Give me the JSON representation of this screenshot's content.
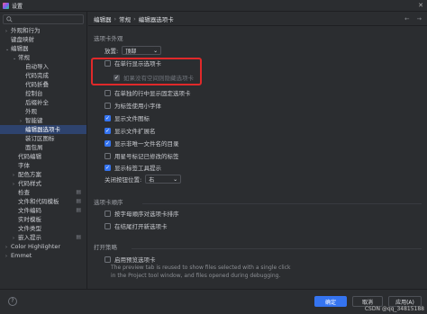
{
  "window": {
    "title": "设置"
  },
  "search": {
    "placeholder": ""
  },
  "sidebar": {
    "items": [
      {
        "label": "外观和行为",
        "indent": 0,
        "arrow": "›"
      },
      {
        "label": "键盘映射",
        "indent": 0,
        "arrow": ""
      },
      {
        "label": "编辑器",
        "indent": 0,
        "arrow": "⌄"
      },
      {
        "label": "常规",
        "indent": 1,
        "arrow": "⌄"
      },
      {
        "label": "自动导入",
        "indent": 2,
        "arrow": ""
      },
      {
        "label": "代码完成",
        "indent": 2,
        "arrow": ""
      },
      {
        "label": "代码折叠",
        "indent": 2,
        "arrow": ""
      },
      {
        "label": "控制台",
        "indent": 2,
        "arrow": ""
      },
      {
        "label": "后缀补全",
        "indent": 2,
        "arrow": ""
      },
      {
        "label": "外观",
        "indent": 2,
        "arrow": ""
      },
      {
        "label": "智能键",
        "indent": 2,
        "arrow": "›"
      },
      {
        "label": "编辑器选项卡",
        "indent": 2,
        "arrow": "",
        "selected": true
      },
      {
        "label": "装订区图标",
        "indent": 2,
        "arrow": ""
      },
      {
        "label": "面包屑",
        "indent": 2,
        "arrow": ""
      },
      {
        "label": "代码编辑",
        "indent": 1,
        "arrow": ""
      },
      {
        "label": "字体",
        "indent": 1,
        "arrow": ""
      },
      {
        "label": "配色方案",
        "indent": 1,
        "arrow": "›"
      },
      {
        "label": "代码样式",
        "indent": 1,
        "arrow": "›"
      },
      {
        "label": "检查",
        "indent": 1,
        "arrow": "",
        "gear": true
      },
      {
        "label": "文件和代码模板",
        "indent": 1,
        "arrow": "",
        "gear": true
      },
      {
        "label": "文件编码",
        "indent": 1,
        "arrow": "",
        "gear": true
      },
      {
        "label": "实时模板",
        "indent": 1,
        "arrow": ""
      },
      {
        "label": "文件类型",
        "indent": 1,
        "arrow": ""
      },
      {
        "label": "嵌入提示",
        "indent": 1,
        "arrow": "›",
        "gear": true
      },
      {
        "label": "Color Highlighter",
        "indent": 0,
        "arrow": "›"
      },
      {
        "label": "Emmet",
        "indent": 0,
        "arrow": "›"
      }
    ]
  },
  "breadcrumb": {
    "part1": "编辑器",
    "sep1": "›",
    "part2": "常规",
    "sep2": "›",
    "part3": "编辑器选项卡",
    "back": "←",
    "forward": "→"
  },
  "sections": {
    "appearance": {
      "title": "选项卡外观",
      "placement_label": "放置:",
      "placement_value": "顶部",
      "options": [
        {
          "label": "在单行显示选项卡",
          "checked": false,
          "disabled": false
        },
        {
          "label": "如果没有空间则隐藏选项卡",
          "checked": true,
          "disabled": true
        },
        {
          "label": "在单独的行中显示固定选项卡",
          "checked": false,
          "disabled": false
        },
        {
          "label": "为标签使用小字体",
          "checked": false,
          "disabled": false
        },
        {
          "label": "显示文件图标",
          "checked": true,
          "disabled": false
        },
        {
          "label": "显示文件扩展名",
          "checked": true,
          "disabled": false
        },
        {
          "label": "显示非唯一文件名的目录",
          "checked": true,
          "disabled": false
        },
        {
          "label": "用星号标记已修改的标签",
          "checked": false,
          "disabled": false
        },
        {
          "label": "显示标签工具提示",
          "checked": true,
          "disabled": false
        }
      ],
      "close_label": "关闭按钮位置:",
      "close_value": "右"
    },
    "order": {
      "title": "选项卡顺序",
      "options": [
        {
          "label": "按字母顺序对选项卡排序",
          "checked": false
        },
        {
          "label": "在结尾打开新选项卡",
          "checked": false
        }
      ]
    },
    "preview": {
      "title": "打开策略",
      "option": {
        "label": "启用预览选项卡",
        "checked": false
      },
      "desc1": "The preview tab is reused to show files selected with a single click",
      "desc2": "in the Project tool window, and files opened during debugging."
    }
  },
  "footer": {
    "help": "?",
    "ok": "确定",
    "cancel": "取消",
    "apply": "应用(A)"
  },
  "watermark": "CSDN @qq_34815188",
  "colors": {
    "accent": "#3574f0",
    "highlight": "#e0292a",
    "selection": "#2e436e"
  }
}
